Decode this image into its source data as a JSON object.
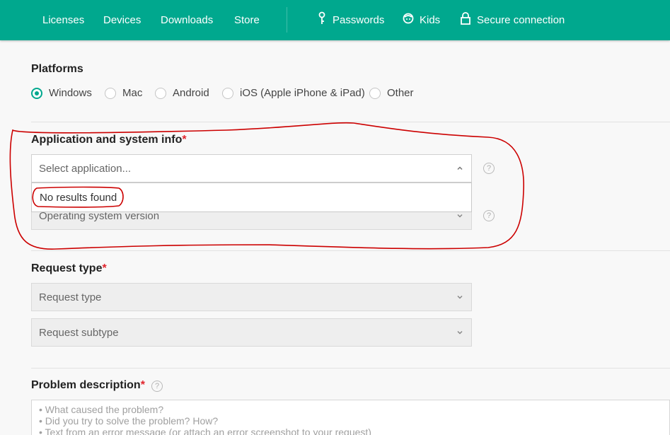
{
  "nav": {
    "items": [
      "Licenses",
      "Devices",
      "Downloads",
      "Store"
    ],
    "tools": [
      {
        "label": "Passwords",
        "icon": "key-icon"
      },
      {
        "label": "Kids",
        "icon": "kids-icon"
      },
      {
        "label": "Secure connection",
        "icon": "lock-icon"
      }
    ]
  },
  "platforms": {
    "title": "Platforms",
    "options": [
      "Windows",
      "Mac",
      "Android",
      "iOS (Apple iPhone & iPad)",
      "Other"
    ],
    "selected": "Windows"
  },
  "app_info": {
    "title": "Application and system info",
    "required_mark": "*",
    "app_select_placeholder": "Select application...",
    "dropdown_message": "No results found",
    "os_select_placeholder": "Operating system version",
    "help_glyph": "?"
  },
  "request": {
    "title": "Request type",
    "required_mark": "*",
    "type_placeholder": "Request type",
    "subtype_placeholder": "Request subtype"
  },
  "problem": {
    "title": "Problem description",
    "required_mark": "*",
    "help_glyph": "?",
    "placeholder_lines": [
      "• What caused the problem?",
      "• Did you try to solve the problem? How?",
      "• Text from an error message (or attach an error screenshot to your request)"
    ]
  },
  "colors": {
    "brand": "#00a88e",
    "required": "#e0242c",
    "annotation": "#cc0000"
  }
}
